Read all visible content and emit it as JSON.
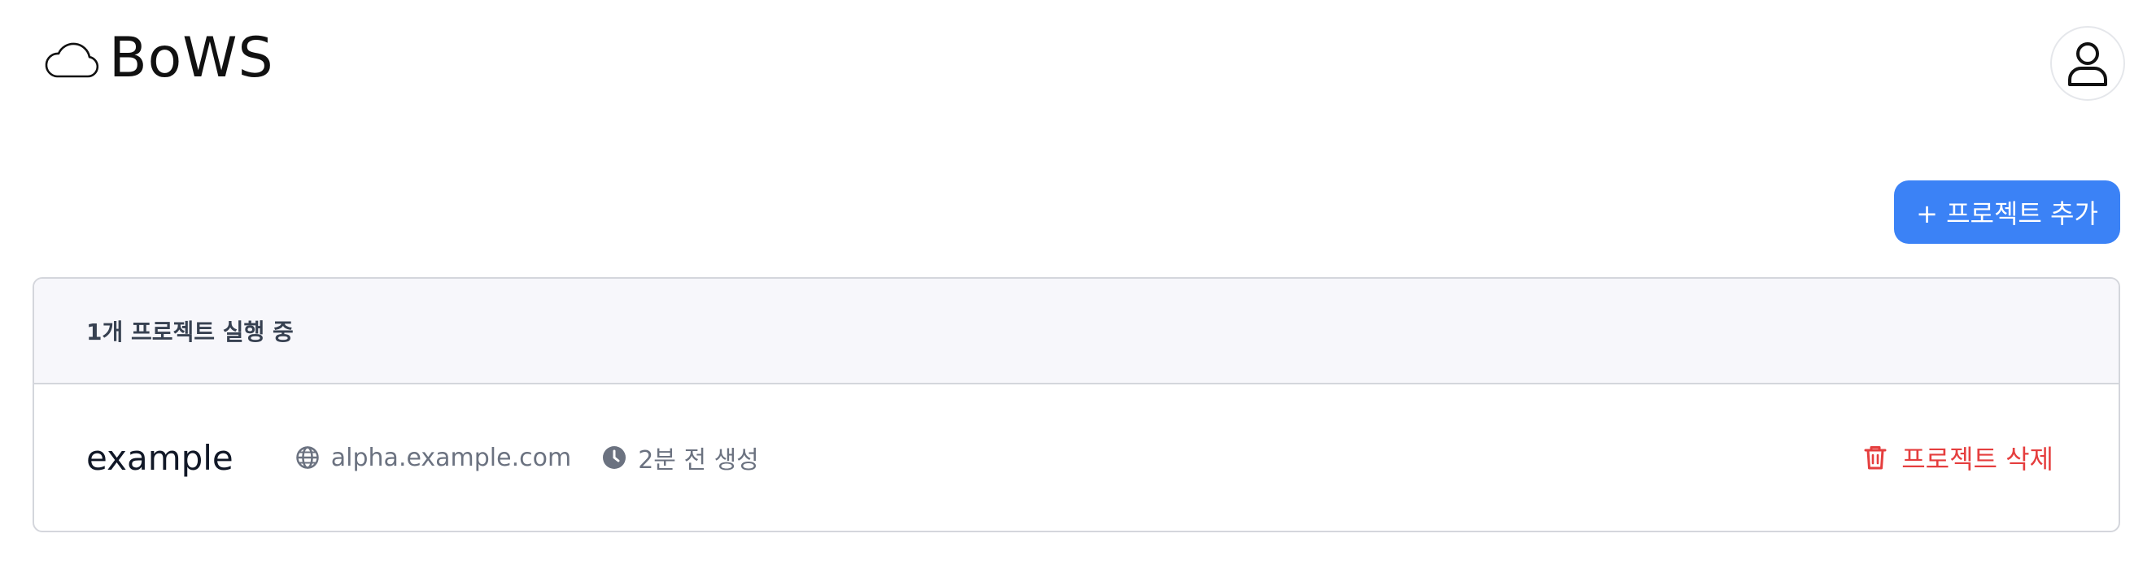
{
  "header": {
    "brand": "BoWS",
    "icons": {
      "logo": "cloud-icon",
      "profile": "user-icon"
    }
  },
  "actions": {
    "add_project_label": "+ 프로젝트 추가"
  },
  "projects_panel": {
    "status_text": "1개 프로젝트 실행 중",
    "items": [
      {
        "name": "example",
        "domain": "alpha.example.com",
        "domain_icon": "globe-icon",
        "created": "2분 전 생성",
        "created_icon": "clock-icon",
        "delete_label": "프로젝트 삭제",
        "delete_icon": "trash-icon"
      }
    ]
  },
  "colors": {
    "accent": "#3b82f6",
    "danger": "#e53e3e",
    "muted_text": "#6b7280",
    "panel_header_bg": "#f7f7fb"
  }
}
